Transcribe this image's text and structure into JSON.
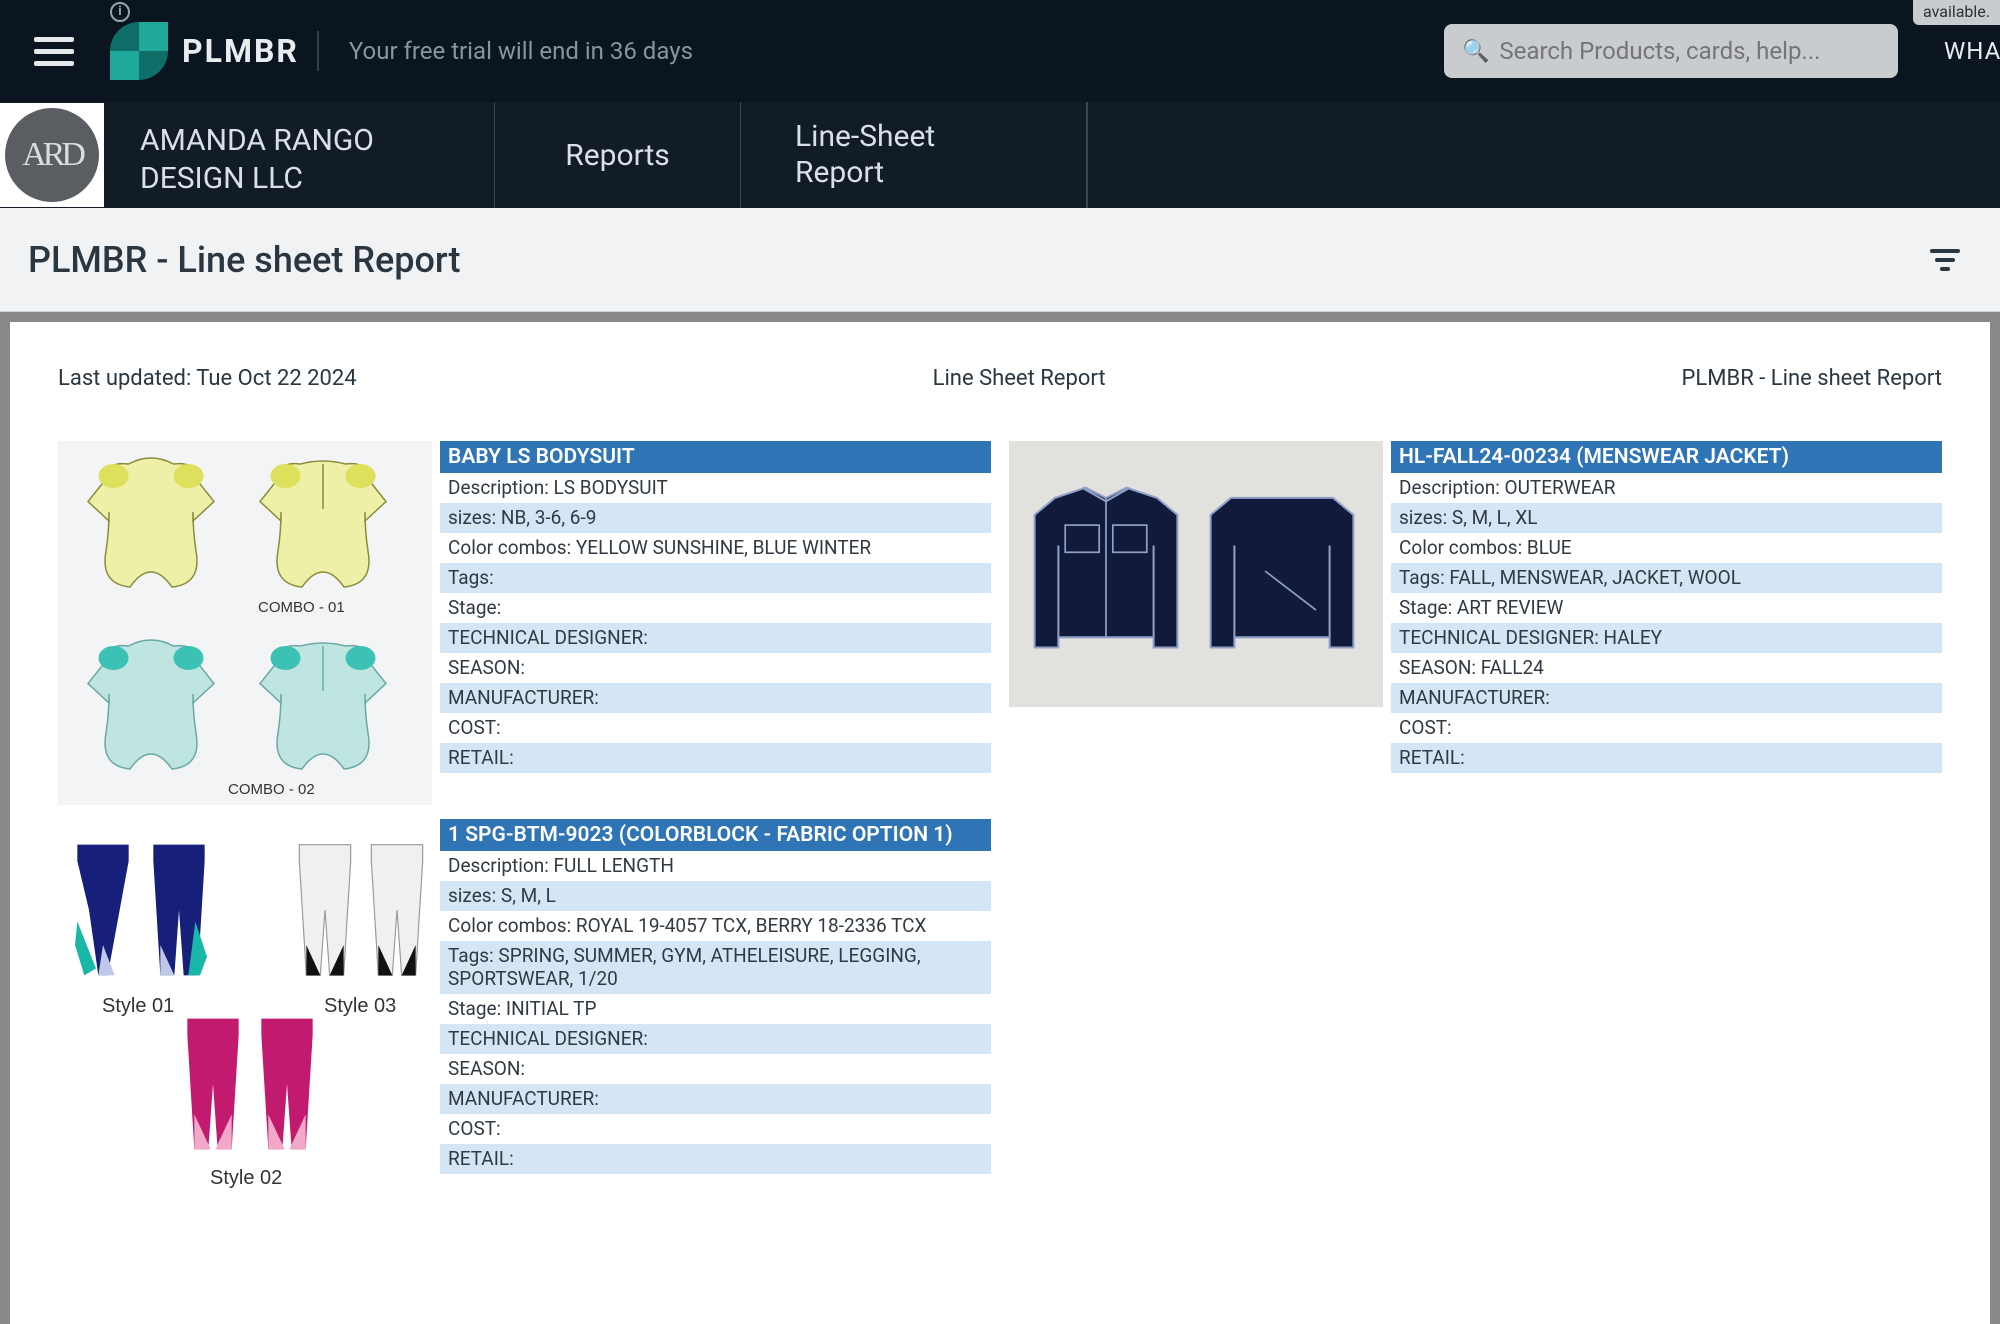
{
  "brand": "PLMBR",
  "trial_msg": "Your free trial will end in 36 days",
  "search_placeholder": "Search Products, cards, help...",
  "avail_chip": "available.",
  "what_button": "WHAT",
  "org": {
    "name_line1": "AMANDA RANGO",
    "name_line2": "DESIGN LLC",
    "logo_initials": "ARD"
  },
  "nav": {
    "reports": "Reports",
    "line_sheet_line1": "Line-Sheet",
    "line_sheet_line2": "Report"
  },
  "page_title": "PLMBR - Line sheet Report",
  "sheet": {
    "last_updated": "Last updated: Tue Oct 22 2024",
    "center": "Line Sheet Report",
    "right": "PLMBR - Line sheet Report"
  },
  "labels": {
    "description": "Description:",
    "sizes": "sizes:",
    "combos": "Color combos:",
    "tags": "Tags:",
    "stage": "Stage:",
    "tech": "TECHNICAL DESIGNER:",
    "season": "SEASON:",
    "manufacturer": "MANUFACTURER:",
    "cost": "COST:",
    "retail": "RETAIL:"
  },
  "cards": [
    {
      "title": "BABY LS BODYSUIT",
      "description": "LS BODYSUIT",
      "sizes": "NB, 3-6, 6-9",
      "combos": "YELLOW SUNSHINE, BLUE WINTER",
      "tags": "",
      "stage": "",
      "tech": "",
      "season": "",
      "manufacturer": "",
      "cost": "",
      "retail": "",
      "thumb": {
        "combo1": "COMBO - 01",
        "combo2": "COMBO - 02"
      }
    },
    {
      "title": "HL-FALL24-00234 (MENSWEAR JACKET)",
      "description": "OUTERWEAR",
      "sizes": "S, M, L, XL",
      "combos": "BLUE",
      "tags": "FALL, MENSWEAR, JACKET, WOOL",
      "stage": "ART REVIEW",
      "tech": "HALEY",
      "season": "FALL24",
      "manufacturer": "",
      "cost": "",
      "retail": ""
    },
    {
      "title": "1 SPG-BTM-9023 (COLORBLOCK - FABRIC OPTION 1)",
      "description": "FULL LENGTH",
      "sizes": "S, M, L",
      "combos": "ROYAL 19-4057 TCX, BERRY 18-2336 TCX",
      "tags": "SPRING, SUMMER, GYM, ATHELEISURE, LEGGING, SPORTSWEAR, 1/20",
      "stage": "INITIAL TP",
      "tech": "",
      "season": "",
      "manufacturer": "",
      "cost": "",
      "retail": "",
      "thumb": {
        "s1": "Style 01",
        "s2": "Style 02",
        "s3": "Style 03"
      }
    }
  ]
}
